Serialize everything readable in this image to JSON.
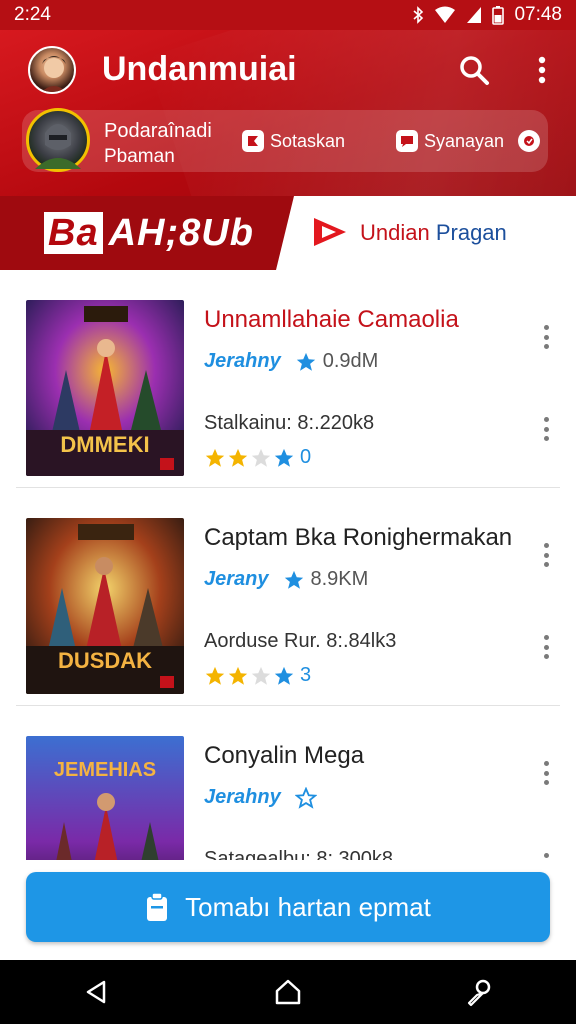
{
  "status_bar": {
    "time": "2:24",
    "clock_right": "07:48"
  },
  "header": {
    "title": "Undanmuiai",
    "profile": {
      "name": "Podaraînadi",
      "subtitle": "Pbaman"
    },
    "pill_one": "Sotaskan",
    "pill_two": "Syanayan"
  },
  "promo": {
    "badge": "Ba",
    "text": "AH;8Ub",
    "button_label_a": "Undian",
    "button_label_b": " Pragan"
  },
  "items": [
    {
      "title": "Unnamllahaie Camaolia",
      "tag": "Jerahny",
      "views": "0.9dM",
      "stats": "Stalkainu: 8:.220k8",
      "rating_count": "0",
      "cover_text": "DMMEKI"
    },
    {
      "title": "Captam Bka Ronighermakan",
      "tag": "Jerany",
      "views": "8.9KM",
      "stats": "Aorduse Rur. 8:.84lk3",
      "rating_count": "3",
      "cover_text": "DUSDAK"
    },
    {
      "title": "Conyalin Mega",
      "tag": "Jerahny",
      "views": "",
      "stats": "Satagealbu: 8:.300k8",
      "rating_count": "",
      "cover_text": "JEMEHIAS"
    }
  ],
  "cta": {
    "label": "Tomabı hartan epmat"
  },
  "colors": {
    "brand_red": "#c4121a",
    "accent_blue": "#1e96e6",
    "star_gold": "#f4b400",
    "star_blue": "#1f8fe0"
  }
}
